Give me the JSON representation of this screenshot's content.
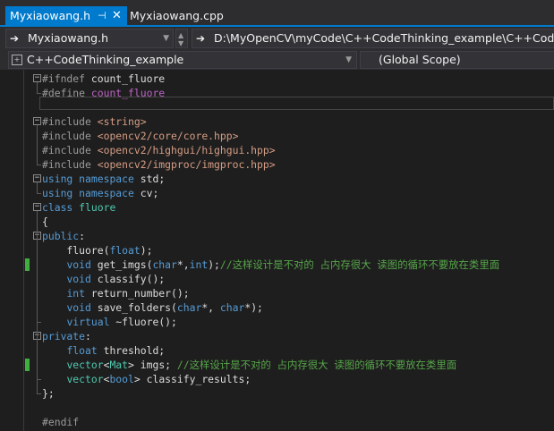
{
  "tabs": [
    {
      "label": "Myxiaowang.h",
      "active": true
    },
    {
      "label": "Myxiaowang.cpp",
      "active": false
    }
  ],
  "tab_icons": {
    "pin": "⊣",
    "close": "✕"
  },
  "nav": {
    "file_dropdown": "Myxiaowang.h",
    "path_dropdown": "D:\\MyOpenCV\\myCode\\C++CodeThinking_example\\C++CodeThinking_example\\Myxiaowang.h",
    "class_dropdown": "C++CodeThinking_example",
    "scope_dropdown": "(Global Scope)"
  },
  "colors": {
    "accent": "#007acc",
    "keyword": "#569cd6",
    "string": "#d69d85",
    "macro": "#bd63c5",
    "comment": "#57a64a",
    "type": "#4ec9b0",
    "change_marker": "#3fae3f"
  },
  "code_lines": [
    {
      "tokens": [
        {
          "t": "p",
          "v": "#ifndef "
        },
        {
          "t": "x",
          "v": "count_fluore"
        }
      ],
      "fold": "minus"
    },
    {
      "tokens": [
        {
          "t": "p",
          "v": "#define "
        },
        {
          "t": "m",
          "v": "count_fluore"
        }
      ]
    },
    {
      "tokens": []
    },
    {
      "tokens": [
        {
          "t": "p",
          "v": "#include "
        },
        {
          "t": "s",
          "v": "<string>"
        }
      ],
      "fold": "minus"
    },
    {
      "tokens": [
        {
          "t": "p",
          "v": "#include "
        },
        {
          "t": "s",
          "v": "<opencv2/core/core.hpp>"
        }
      ]
    },
    {
      "tokens": [
        {
          "t": "p",
          "v": "#include "
        },
        {
          "t": "s",
          "v": "<opencv2/highgui/highgui.hpp>"
        }
      ]
    },
    {
      "tokens": [
        {
          "t": "p",
          "v": "#include "
        },
        {
          "t": "s",
          "v": "<opencv2/imgproc/imgproc.hpp>"
        }
      ]
    },
    {
      "tokens": [
        {
          "t": "k",
          "v": "using"
        },
        {
          "t": "x",
          "v": " "
        },
        {
          "t": "k",
          "v": "namespace"
        },
        {
          "t": "x",
          "v": " std;"
        }
      ],
      "fold": "minus"
    },
    {
      "tokens": [
        {
          "t": "k",
          "v": "using"
        },
        {
          "t": "x",
          "v": " "
        },
        {
          "t": "k",
          "v": "namespace"
        },
        {
          "t": "x",
          "v": " cv;"
        }
      ]
    },
    {
      "tokens": [
        {
          "t": "k",
          "v": "class"
        },
        {
          "t": "x",
          "v": " "
        },
        {
          "t": "t",
          "v": "fluore"
        }
      ],
      "fold": "minus"
    },
    {
      "tokens": [
        {
          "t": "x",
          "v": "{"
        }
      ]
    },
    {
      "tokens": [
        {
          "t": "k",
          "v": "public"
        },
        {
          "t": "x",
          "v": ":"
        }
      ],
      "fold": "minus"
    },
    {
      "tokens": [
        {
          "t": "x",
          "v": "    fluore("
        },
        {
          "t": "k",
          "v": "float"
        },
        {
          "t": "x",
          "v": ");"
        }
      ]
    },
    {
      "tokens": [
        {
          "t": "x",
          "v": "    "
        },
        {
          "t": "k",
          "v": "void"
        },
        {
          "t": "x",
          "v": " get_imgs("
        },
        {
          "t": "k",
          "v": "char"
        },
        {
          "t": "x",
          "v": "*,"
        },
        {
          "t": "k",
          "v": "int"
        },
        {
          "t": "x",
          "v": ");"
        },
        {
          "t": "c",
          "v": "//这样设计是不对的 占内存很大 读图的循环不要放在类里面"
        }
      ],
      "changed": true
    },
    {
      "tokens": [
        {
          "t": "x",
          "v": "    "
        },
        {
          "t": "k",
          "v": "void"
        },
        {
          "t": "x",
          "v": " classify();"
        }
      ]
    },
    {
      "tokens": [
        {
          "t": "x",
          "v": "    "
        },
        {
          "t": "k",
          "v": "int"
        },
        {
          "t": "x",
          "v": " return_number();"
        }
      ]
    },
    {
      "tokens": [
        {
          "t": "x",
          "v": "    "
        },
        {
          "t": "k",
          "v": "void"
        },
        {
          "t": "x",
          "v": " save_folders("
        },
        {
          "t": "k",
          "v": "char"
        },
        {
          "t": "x",
          "v": "*, "
        },
        {
          "t": "k",
          "v": "char"
        },
        {
          "t": "x",
          "v": "*);"
        }
      ]
    },
    {
      "tokens": [
        {
          "t": "x",
          "v": "    "
        },
        {
          "t": "k",
          "v": "virtual"
        },
        {
          "t": "x",
          "v": " ~fluore();"
        }
      ]
    },
    {
      "tokens": [
        {
          "t": "k",
          "v": "private"
        },
        {
          "t": "x",
          "v": ":"
        }
      ],
      "fold": "minus"
    },
    {
      "tokens": [
        {
          "t": "x",
          "v": "    "
        },
        {
          "t": "k",
          "v": "float"
        },
        {
          "t": "x",
          "v": " threshold;"
        }
      ]
    },
    {
      "tokens": [
        {
          "t": "x",
          "v": "    "
        },
        {
          "t": "t",
          "v": "vector"
        },
        {
          "t": "x",
          "v": "<"
        },
        {
          "t": "t",
          "v": "Mat"
        },
        {
          "t": "x",
          "v": "> imgs; "
        },
        {
          "t": "c",
          "v": "//这样设计是不对的 占内存很大 读图的循环不要放在类里面"
        }
      ],
      "changed": true
    },
    {
      "tokens": [
        {
          "t": "x",
          "v": "    "
        },
        {
          "t": "t",
          "v": "vector"
        },
        {
          "t": "x",
          "v": "<"
        },
        {
          "t": "k",
          "v": "bool"
        },
        {
          "t": "x",
          "v": "> classify_results;"
        }
      ]
    },
    {
      "tokens": [
        {
          "t": "x",
          "v": "};"
        }
      ]
    },
    {
      "tokens": []
    },
    {
      "tokens": [
        {
          "t": "p",
          "v": "#endif"
        }
      ]
    }
  ]
}
